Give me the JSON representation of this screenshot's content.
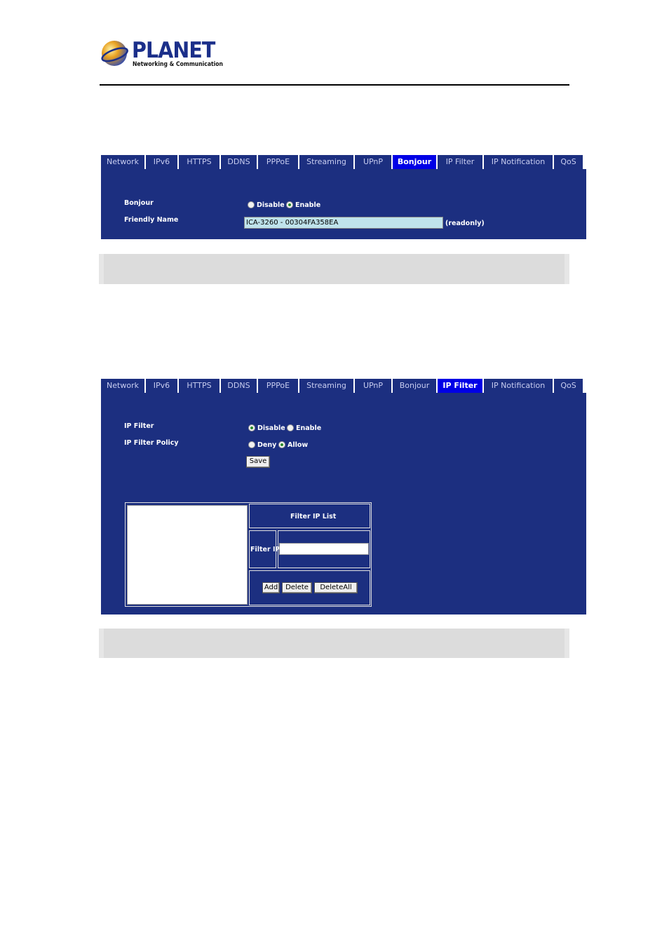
{
  "logo": {
    "brand": "PLANET",
    "tagline": "Networking & Communication"
  },
  "bonjour_panel": {
    "tabs": [
      {
        "label": "Network",
        "active": false
      },
      {
        "label": "IPv6",
        "active": false
      },
      {
        "label": "HTTPS",
        "active": false
      },
      {
        "label": "DDNS",
        "active": false
      },
      {
        "label": "PPPoE",
        "active": false
      },
      {
        "label": "Streaming",
        "active": false
      },
      {
        "label": "UPnP",
        "active": false
      },
      {
        "label": "Bonjour",
        "active": true
      },
      {
        "label": "IP Filter",
        "active": false
      },
      {
        "label": "IP Notification",
        "active": false
      },
      {
        "label": "QoS",
        "active": false
      }
    ],
    "bonjour_label": "Bonjour",
    "disable_label": "Disable",
    "enable_label": "Enable",
    "selected": "Enable",
    "friendly_name_label": "Friendly Name",
    "friendly_name_value": "ICA-3260 - 00304FA358EA",
    "readonly_note": "(readonly)"
  },
  "ipfilter_panel": {
    "tabs": [
      {
        "label": "Network",
        "active": false
      },
      {
        "label": "IPv6",
        "active": false
      },
      {
        "label": "HTTPS",
        "active": false
      },
      {
        "label": "DDNS",
        "active": false
      },
      {
        "label": "PPPoE",
        "active": false
      },
      {
        "label": "Streaming",
        "active": false
      },
      {
        "label": "UPnP",
        "active": false
      },
      {
        "label": "Bonjour",
        "active": false
      },
      {
        "label": "IP Filter",
        "active": true
      },
      {
        "label": "IP Notification",
        "active": false
      },
      {
        "label": "QoS",
        "active": false
      }
    ],
    "ip_filter_label": "IP Filter",
    "disable_label": "Disable",
    "enable_label": "Enable",
    "ip_filter_selected": "Disable",
    "policy_label": "IP Filter Policy",
    "deny_label": "Deny",
    "allow_label": "Allow",
    "policy_selected": "Allow",
    "save_label": "Save",
    "filter_list_header": "Filter IP List",
    "filter_ip_label": "Filter IP",
    "filter_ip_value": "",
    "add_label": "Add",
    "delete_label": "Delete",
    "delete_all_label": "DeleteAll"
  }
}
